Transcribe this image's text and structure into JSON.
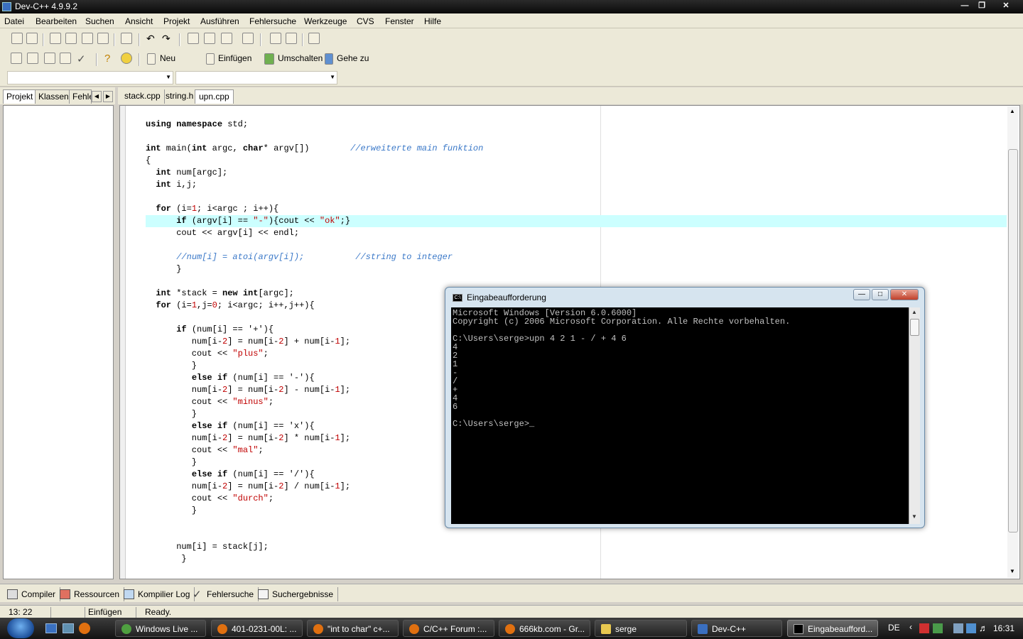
{
  "window": {
    "title": "Dev-C++ 4.9.9.2"
  },
  "menu": [
    "Datei",
    "Bearbeiten",
    "Suchen",
    "Ansicht",
    "Projekt",
    "Ausführen",
    "Fehlersuche",
    "Werkzeuge",
    "CVS",
    "Fenster",
    "Hilfe"
  ],
  "toolbar2": {
    "neu": "Neu",
    "einfuegen": "Einfügen",
    "umschalten": "Umschalten",
    "gehezu": "Gehe zu"
  },
  "left_tabs": [
    "Projekt",
    "Klassen",
    "Fehle"
  ],
  "file_tabs": [
    "stack.cpp",
    "string.h",
    "upn.cpp"
  ],
  "code": [
    {
      "t": "using namespace std;"
    },
    {
      "t": ""
    },
    {
      "t": "int main(int argc, char* argv[])        //erweiterte main funktion"
    },
    {
      "t": "{"
    },
    {
      "t": "  int num[argc];"
    },
    {
      "t": "  int i,j;"
    },
    {
      "t": ""
    },
    {
      "t": "  for (i=1; i<argc ; i++){"
    },
    {
      "t": "      if (argv[i] == \"-\"){cout << \"ok\";}"
    },
    {
      "t": "      cout << argv[i] << endl;"
    },
    {
      "t": ""
    },
    {
      "t": "      //num[i] = atoi(argv[i]);          //string to integer"
    },
    {
      "t": "      }"
    },
    {
      "t": ""
    },
    {
      "t": "  int *stack = new int[argc];"
    },
    {
      "t": "  for (i=1,j=0; i<argc; i++,j++){"
    },
    {
      "t": ""
    },
    {
      "t": "      if (num[i] == '+'){"
    },
    {
      "t": "         num[i-2] = num[i-2] + num[i-1];"
    },
    {
      "t": "         cout << \"plus\";"
    },
    {
      "t": "         }"
    },
    {
      "t": "         else if (num[i] == '-'){"
    },
    {
      "t": "         num[i-2] = num[i-2] - num[i-1];"
    },
    {
      "t": "         cout << \"minus\";"
    },
    {
      "t": "         }"
    },
    {
      "t": "         else if (num[i] == 'x'){"
    },
    {
      "t": "         num[i-2] = num[i-2] * num[i-1];"
    },
    {
      "t": "         cout << \"mal\";"
    },
    {
      "t": "         }"
    },
    {
      "t": "         else if (num[i] == '/'){"
    },
    {
      "t": "         num[i-2] = num[i-2] / num[i-1];"
    },
    {
      "t": "         cout << \"durch\";"
    },
    {
      "t": "         }"
    },
    {
      "t": ""
    },
    {
      "t": ""
    },
    {
      "t": "      num[i] = stack[j];"
    },
    {
      "t": "       }"
    }
  ],
  "bottom_tabs": [
    "Compiler",
    "Ressourcen",
    "Kompilier Log",
    "Fehlersuche",
    "Suchergebnisse"
  ],
  "status": {
    "pos": "13: 22",
    "mode": "Einfügen",
    "state": "Ready."
  },
  "console": {
    "title": "Eingabeaufforderung",
    "lines": [
      "Microsoft Windows [Version 6.0.6000]",
      "Copyright (c) 2006 Microsoft Corporation. Alle Rechte vorbehalten.",
      "",
      "C:\\Users\\serge>upn 4 2 1 - / + 4 6",
      "4",
      "2",
      "1",
      "-",
      "/",
      "+",
      "4",
      "6",
      "",
      "C:\\Users\\serge>_"
    ]
  },
  "taskbar": {
    "tasks": [
      "Windows Live ...",
      "401-0231-00L: ...",
      "\"int to char\" c+...",
      "C/C++ Forum :...",
      "666kb.com - Gr...",
      "serge",
      "Dev-C++",
      "Eingabeaufford..."
    ],
    "lang": "DE",
    "clock": "16:31"
  }
}
